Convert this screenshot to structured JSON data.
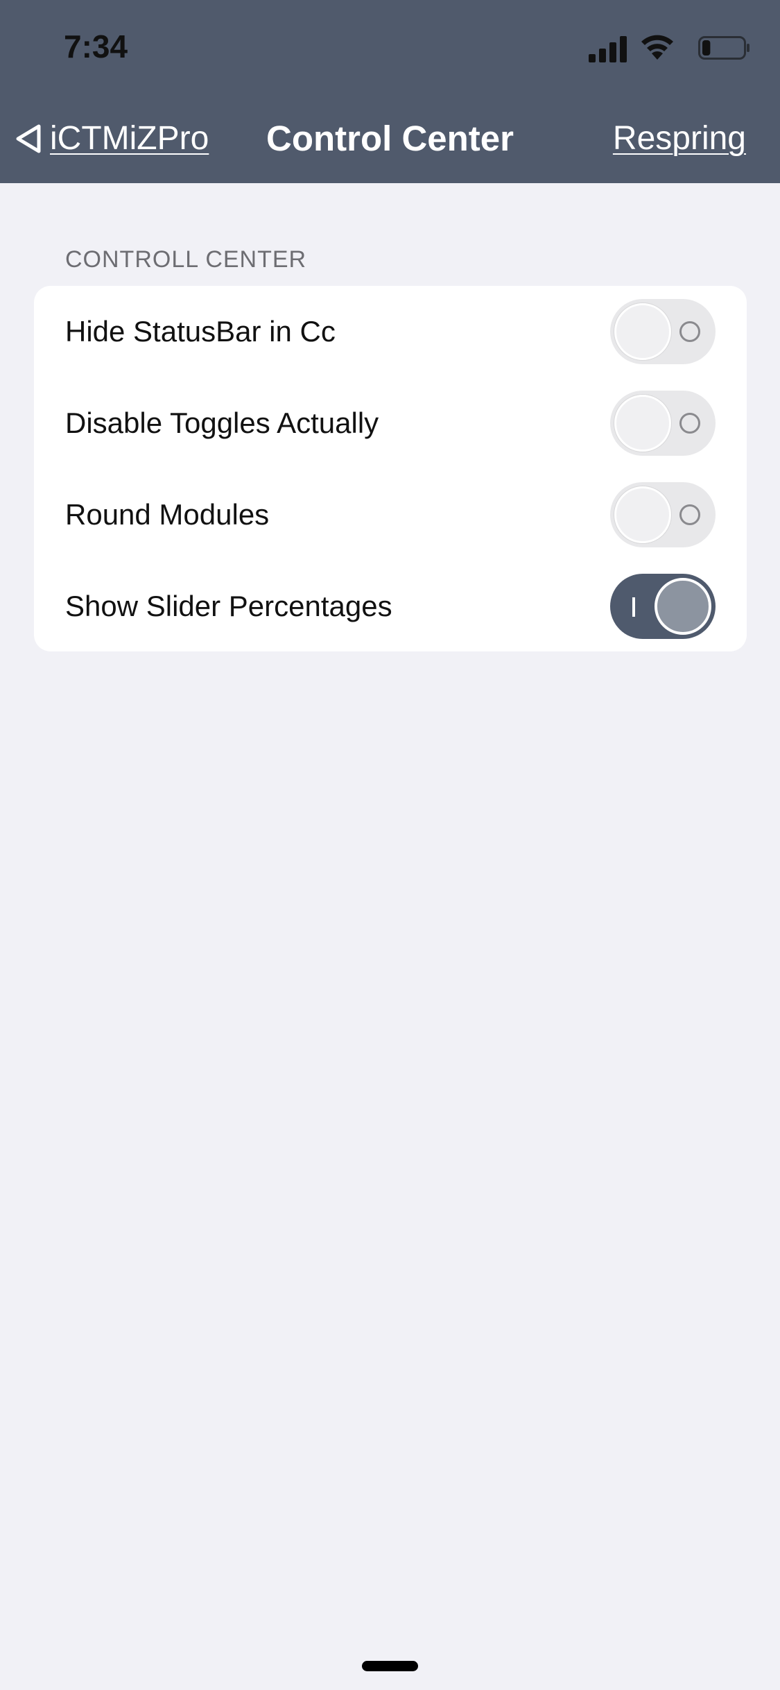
{
  "status_bar": {
    "time": "7:34",
    "icons": [
      "signal-icon",
      "wifi-icon",
      "battery-icon"
    ],
    "battery_level": 0.2
  },
  "nav": {
    "back_label": "iCTMiZPro",
    "title": "Control Center",
    "right_label": "Respring"
  },
  "section": {
    "header": "CONTROLL CENTER",
    "rows": [
      {
        "label": "Hide StatusBar in Cc",
        "on": false
      },
      {
        "label": "Disable Toggles Actually",
        "on": false
      },
      {
        "label": "Round Modules",
        "on": false
      },
      {
        "label": "Show Slider Percentages",
        "on": true
      }
    ]
  },
  "colors": {
    "header_bg": "#505a6c",
    "page_bg": "#f1f1f6",
    "switch_on": "#4f5a6d",
    "switch_off": "#e8e8ea"
  }
}
